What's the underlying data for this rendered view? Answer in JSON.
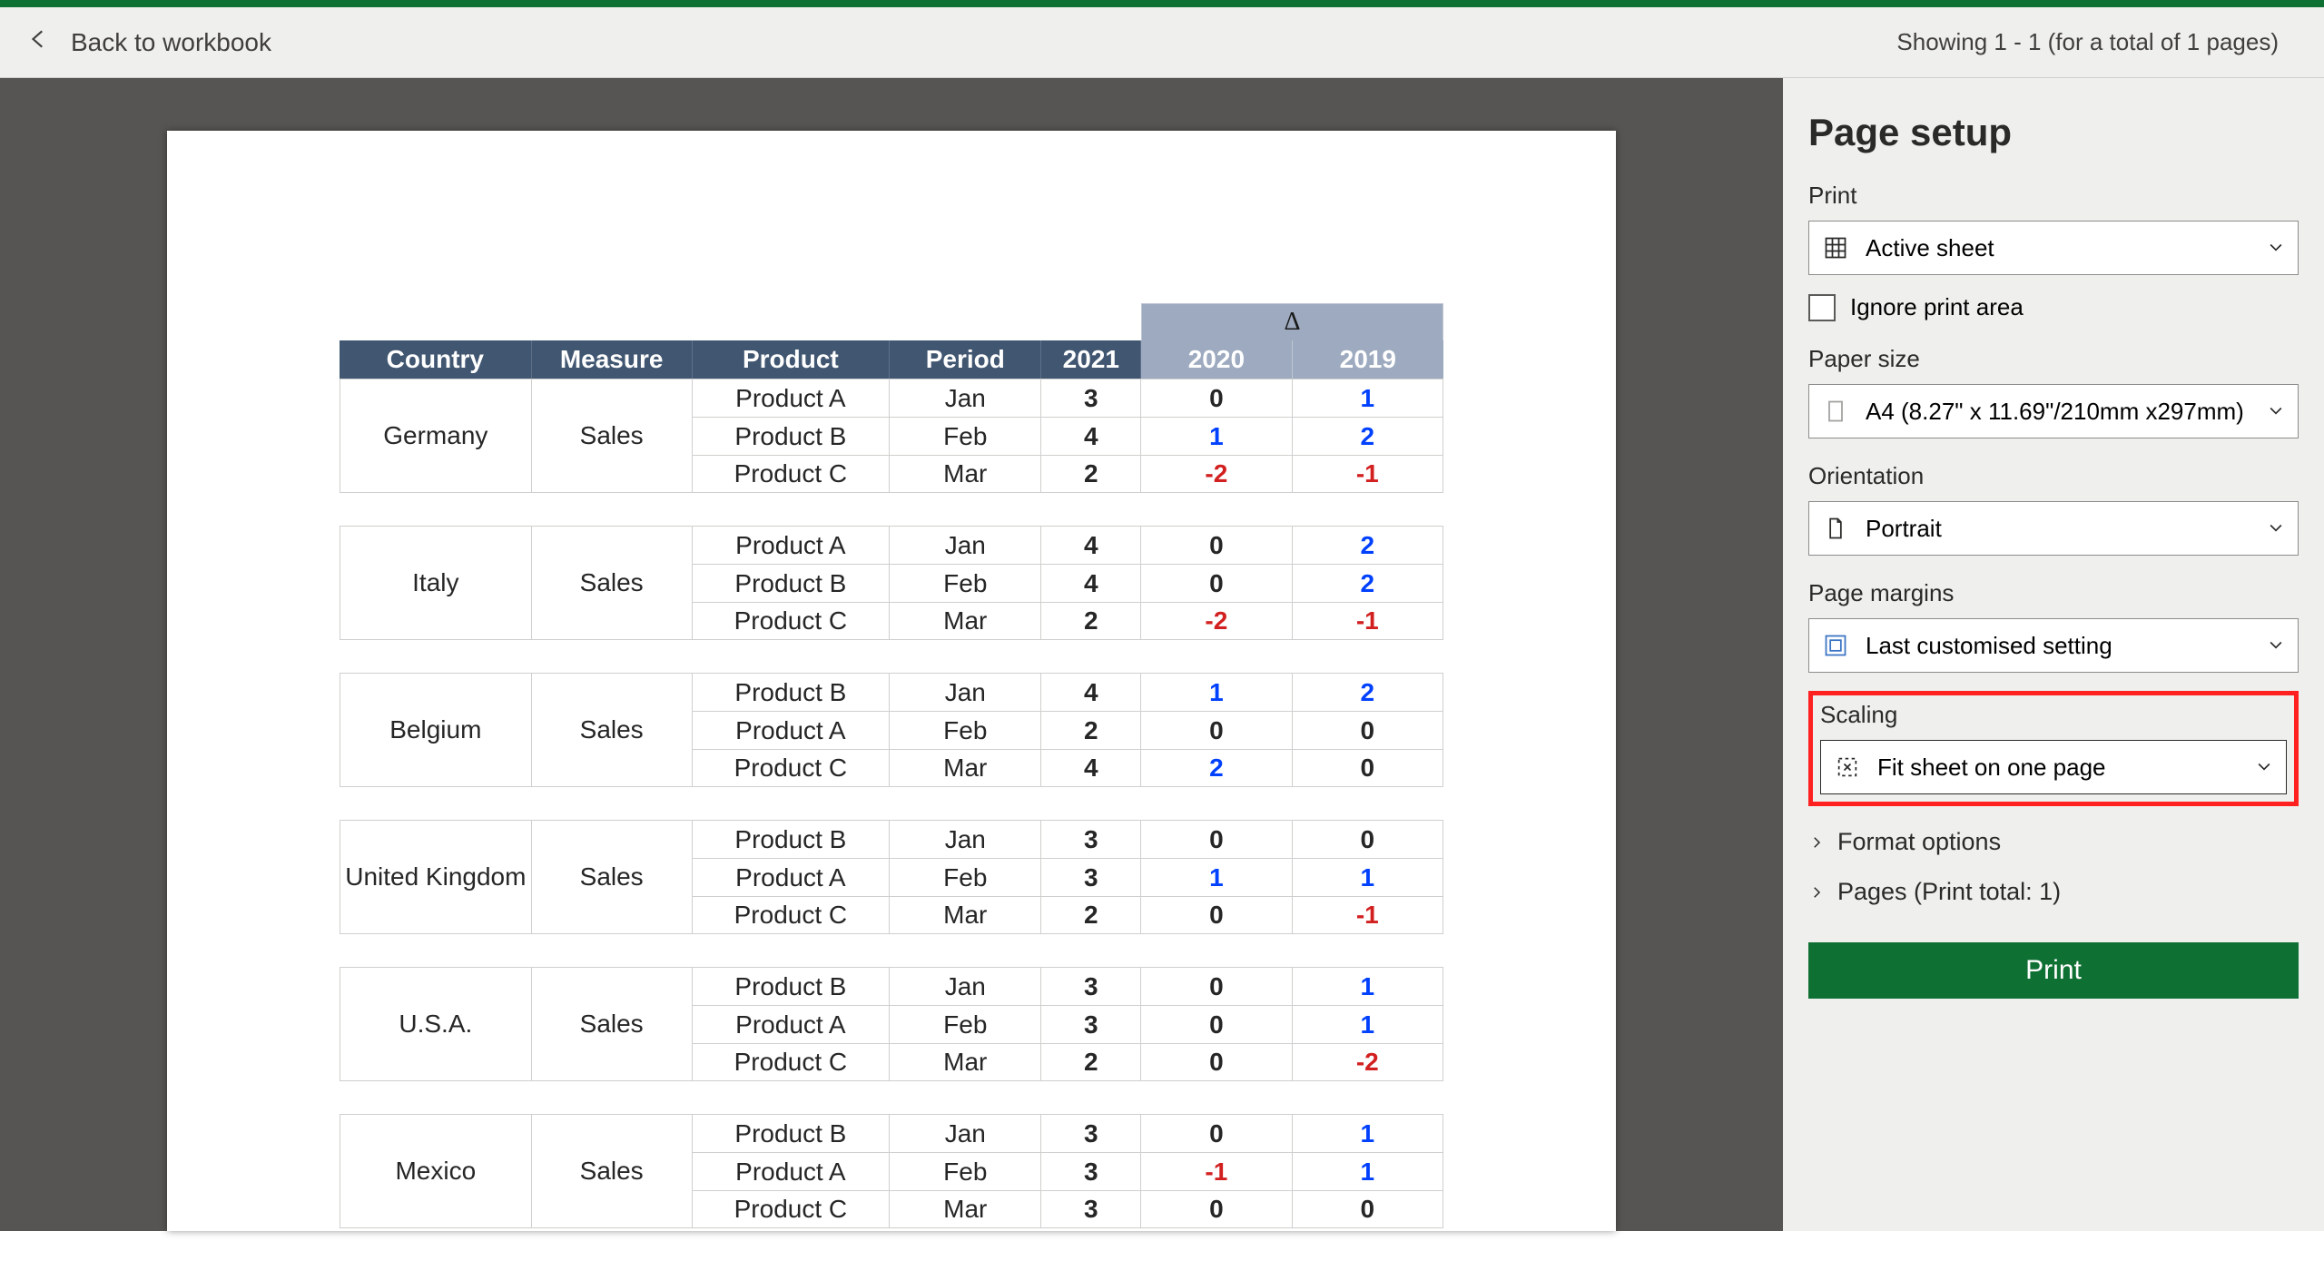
{
  "header": {
    "back_label": "Back to workbook",
    "showing_text": "Showing 1 - 1 (for a total of 1 pages)"
  },
  "sidebar": {
    "title": "Page setup",
    "groups": {
      "print_label": "Print",
      "print_value": "Active sheet",
      "ignore_label": "Ignore print area",
      "paper_label": "Paper size",
      "paper_value": "A4 (8.27\" x 11.69\"/210mm x297mm)",
      "orientation_label": "Orientation",
      "orientation_value": "Portrait",
      "margins_label": "Page margins",
      "margins_value": "Last customised setting",
      "scaling_label": "Scaling",
      "scaling_value": "Fit sheet on one page"
    },
    "accordion": {
      "format_options": "Format options",
      "pages_label": "Pages (Print total: 1)"
    },
    "print_button": "Print"
  },
  "table": {
    "delta_symbol": "Δ",
    "headers": {
      "country": "Country",
      "measure": "Measure",
      "product": "Product",
      "period": "Period",
      "y2021": "2021",
      "y2020": "2020",
      "y2019": "2019"
    },
    "blocks": [
      {
        "country": "Germany",
        "measure": "Sales",
        "rows": [
          {
            "product": "Product A",
            "period": "Jan",
            "y2021": "3",
            "y2020": "0",
            "y2019": "1",
            "c20": "black",
            "c19": "blue"
          },
          {
            "product": "Product B",
            "period": "Feb",
            "y2021": "4",
            "y2020": "1",
            "y2019": "2",
            "c20": "blue",
            "c19": "blue"
          },
          {
            "product": "Product C",
            "period": "Mar",
            "y2021": "2",
            "y2020": "-2",
            "y2019": "-1",
            "c20": "red",
            "c19": "red"
          }
        ]
      },
      {
        "country": "Italy",
        "measure": "Sales",
        "rows": [
          {
            "product": "Product A",
            "period": "Jan",
            "y2021": "4",
            "y2020": "0",
            "y2019": "2",
            "c20": "black",
            "c19": "blue"
          },
          {
            "product": "Product B",
            "period": "Feb",
            "y2021": "4",
            "y2020": "0",
            "y2019": "2",
            "c20": "black",
            "c19": "blue"
          },
          {
            "product": "Product C",
            "period": "Mar",
            "y2021": "2",
            "y2020": "-2",
            "y2019": "-1",
            "c20": "red",
            "c19": "red"
          }
        ]
      },
      {
        "country": "Belgium",
        "measure": "Sales",
        "rows": [
          {
            "product": "Product B",
            "period": "Jan",
            "y2021": "4",
            "y2020": "1",
            "y2019": "2",
            "c20": "blue",
            "c19": "blue"
          },
          {
            "product": "Product A",
            "period": "Feb",
            "y2021": "2",
            "y2020": "0",
            "y2019": "0",
            "c20": "black",
            "c19": "black"
          },
          {
            "product": "Product C",
            "period": "Mar",
            "y2021": "4",
            "y2020": "2",
            "y2019": "0",
            "c20": "blue",
            "c19": "black"
          }
        ]
      },
      {
        "country": "United Kingdom",
        "measure": "Sales",
        "rows": [
          {
            "product": "Product B",
            "period": "Jan",
            "y2021": "3",
            "y2020": "0",
            "y2019": "0",
            "c20": "black",
            "c19": "black"
          },
          {
            "product": "Product A",
            "period": "Feb",
            "y2021": "3",
            "y2020": "1",
            "y2019": "1",
            "c20": "blue",
            "c19": "blue"
          },
          {
            "product": "Product C",
            "period": "Mar",
            "y2021": "2",
            "y2020": "0",
            "y2019": "-1",
            "c20": "black",
            "c19": "red"
          }
        ]
      },
      {
        "country": "U.S.A.",
        "measure": "Sales",
        "rows": [
          {
            "product": "Product B",
            "period": "Jan",
            "y2021": "3",
            "y2020": "0",
            "y2019": "1",
            "c20": "black",
            "c19": "blue"
          },
          {
            "product": "Product A",
            "period": "Feb",
            "y2021": "3",
            "y2020": "0",
            "y2019": "1",
            "c20": "black",
            "c19": "blue"
          },
          {
            "product": "Product C",
            "period": "Mar",
            "y2021": "2",
            "y2020": "0",
            "y2019": "-2",
            "c20": "black",
            "c19": "red"
          }
        ]
      },
      {
        "country": "Mexico",
        "measure": "Sales",
        "rows": [
          {
            "product": "Product B",
            "period": "Jan",
            "y2021": "3",
            "y2020": "0",
            "y2019": "1",
            "c20": "black",
            "c19": "blue"
          },
          {
            "product": "Product A",
            "period": "Feb",
            "y2021": "3",
            "y2020": "-1",
            "y2019": "1",
            "c20": "red",
            "c19": "blue"
          },
          {
            "product": "Product C",
            "period": "Mar",
            "y2021": "3",
            "y2020": "0",
            "y2019": "0",
            "c20": "black",
            "c19": "black"
          }
        ]
      }
    ]
  }
}
